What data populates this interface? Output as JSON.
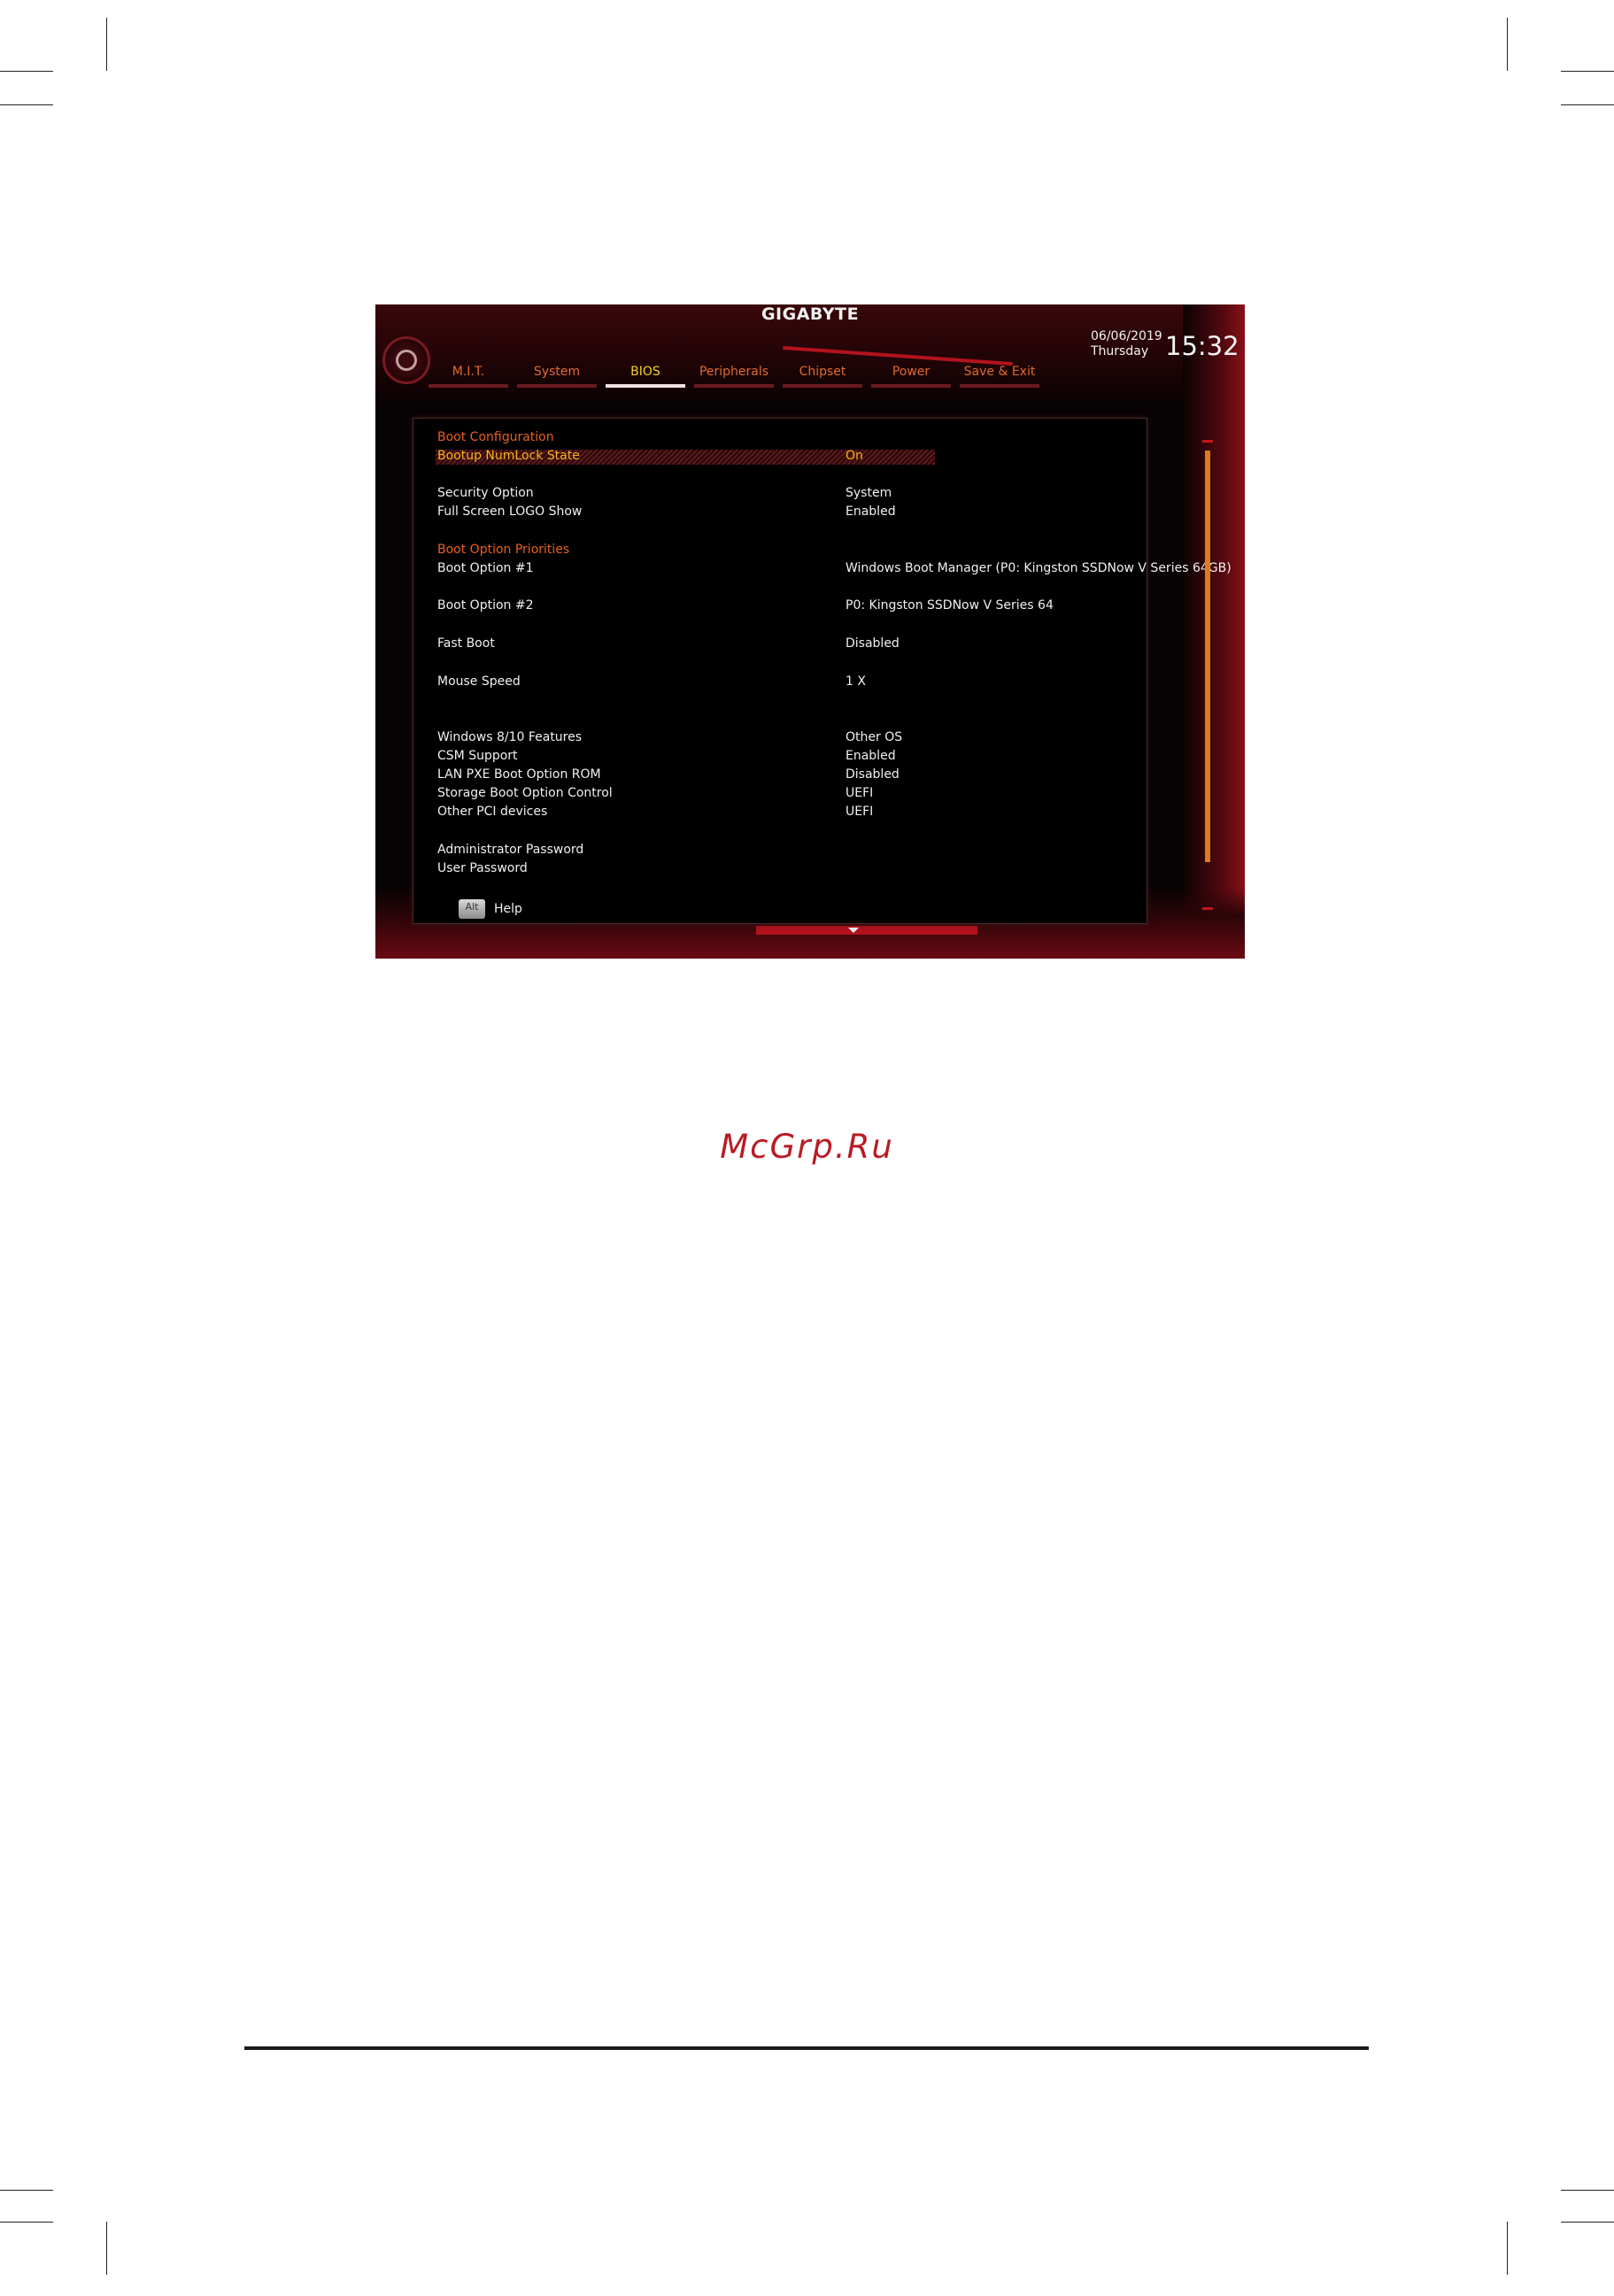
{
  "app": {
    "brand": "GIGABYTE",
    "date": "06/06/2019",
    "day": "Thursday",
    "time": "15:32"
  },
  "tabs": [
    {
      "label": "M.I.T.",
      "active": false
    },
    {
      "label": "System",
      "active": false
    },
    {
      "label": "BIOS",
      "active": true
    },
    {
      "label": "Peripherals",
      "active": false
    },
    {
      "label": "Chipset",
      "active": false
    },
    {
      "label": "Power",
      "active": false
    },
    {
      "label": "Save & Exit",
      "active": false
    }
  ],
  "sections": {
    "boot_configuration": "Boot Configuration",
    "boot_option_priorities": "Boot Option Priorities"
  },
  "settings": [
    {
      "label": "Bootup NumLock State",
      "value": "On"
    },
    {
      "label": "Security Option",
      "value": "System"
    },
    {
      "label": "Full Screen LOGO Show",
      "value": "Enabled"
    },
    {
      "label": "Boot Option #1",
      "value": "Windows Boot Manager (P0: Kingston SSDNow V Series 64GB)"
    },
    {
      "label": "Boot Option #2",
      "value": "P0: Kingston SSDNow V Series 64"
    },
    {
      "label": "Fast Boot",
      "value": "Disabled"
    },
    {
      "label": "Mouse Speed",
      "value": "1 X"
    },
    {
      "label": "Windows 8/10 Features",
      "value": "Other OS"
    },
    {
      "label": "CSM Support",
      "value": "Enabled"
    },
    {
      "label": "LAN PXE Boot Option ROM",
      "value": "Disabled"
    },
    {
      "label": "Storage Boot Option Control",
      "value": "UEFI"
    },
    {
      "label": "Other PCI devices",
      "value": "UEFI"
    },
    {
      "label": "Administrator Password",
      "value": ""
    },
    {
      "label": "User Password",
      "value": ""
    }
  ],
  "help": {
    "key": "Alt",
    "label": "Help"
  },
  "watermark": "McGrp.Ru",
  "colors": {
    "accent_orange": "#e8601e",
    "selected_yellow": "#f5b21a",
    "brand_red": "#b3131d"
  }
}
